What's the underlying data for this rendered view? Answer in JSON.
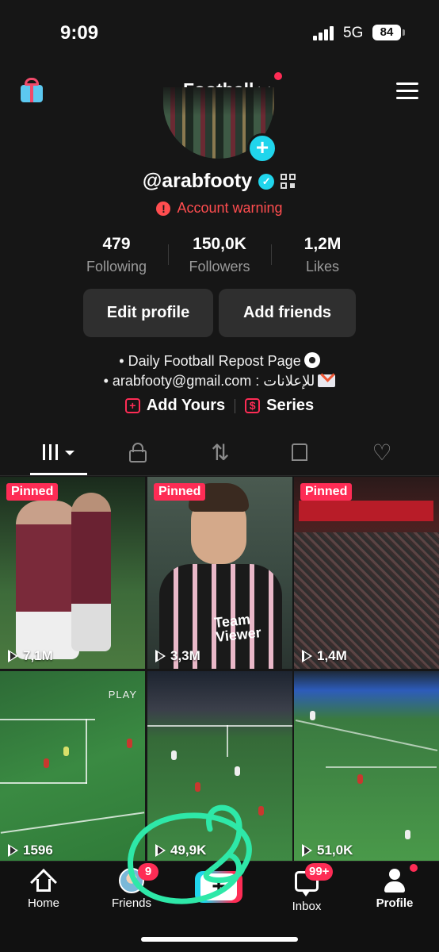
{
  "status_bar": {
    "time": "9:09",
    "network": "5G",
    "battery": "84"
  },
  "header": {
    "title": "Football"
  },
  "profile": {
    "username": "@arabfooty",
    "warning": "Account warning",
    "stats": [
      {
        "value": "479",
        "label": "Following"
      },
      {
        "value": "150,0K",
        "label": "Followers"
      },
      {
        "value": "1,2M",
        "label": "Likes"
      }
    ],
    "buttons": {
      "edit": "Edit profile",
      "add_friends": "Add friends"
    },
    "bio_line1": "• Daily Football Repost Page",
    "bio_line2": "• arabfooty@gmail.com : للإعلانات",
    "links": {
      "add_yours": "Add Yours",
      "series": "Series"
    }
  },
  "videos": [
    {
      "pinned": "Pinned",
      "views": "7,1M"
    },
    {
      "pinned": "Pinned",
      "views": "3,3M",
      "sponsor": "Team Viewer"
    },
    {
      "pinned": "Pinned",
      "views": "1,4M"
    },
    {
      "views": "1596",
      "overlay_text": "PLAY"
    },
    {
      "views": "49,9K"
    },
    {
      "views": "51,0K"
    }
  ],
  "bottom_nav": {
    "home": "Home",
    "friends": "Friends",
    "friends_badge": "9",
    "inbox": "Inbox",
    "inbox_badge": "99+",
    "profile": "Profile"
  },
  "colors": {
    "accent": "#fe2c55",
    "teal": "#20d5ec",
    "annotation": "#2ee8a8"
  },
  "icons": [
    "gift-icon",
    "chevron-down-icon",
    "menu-icon",
    "add-icon",
    "verified-icon",
    "qr-code-icon",
    "warning-icon",
    "soccer-ball-icon",
    "envelope-icon",
    "grid-icon",
    "lock-icon",
    "repost-icon",
    "bookmark-icon",
    "heart-icon",
    "play-icon",
    "home-icon",
    "inbox-icon",
    "profile-icon"
  ]
}
